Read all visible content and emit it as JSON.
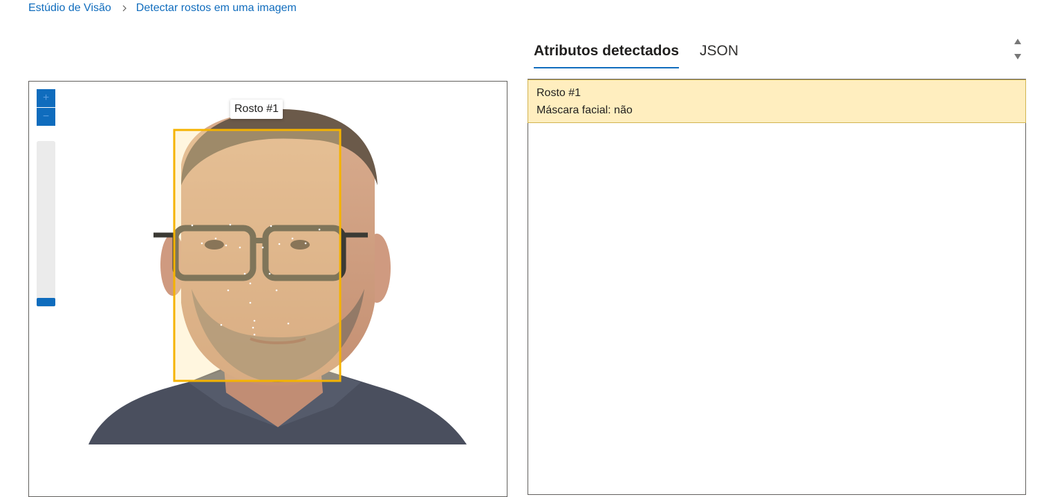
{
  "breadcrumb": {
    "home": "Estúdio de Visão",
    "current": "Detectar rostos em uma imagem"
  },
  "zoom": {
    "in_label": "+",
    "out_label": "−"
  },
  "face_box": {
    "label": "Rosto #1"
  },
  "tabs": [
    {
      "label": "Atributos detectados",
      "active": true
    },
    {
      "label": "JSON",
      "active": false
    }
  ],
  "results": [
    {
      "title": "Rosto #1",
      "detail": "Máscara facial: não"
    }
  ],
  "colors": {
    "accent": "#0f6cbd",
    "face_box": "#f5b300",
    "highlight": "#ffeebf"
  },
  "icons": [
    "chevron-right-icon",
    "arrow-up-icon",
    "arrow-down-icon",
    "zoom-in-icon",
    "zoom-out-icon"
  ]
}
